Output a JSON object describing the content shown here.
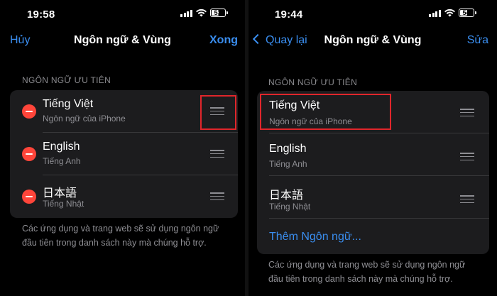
{
  "left": {
    "status": {
      "time": "19:58",
      "battery": "53"
    },
    "nav": {
      "left_button": "Hủy",
      "title": "Ngôn ngữ & Vùng",
      "right_button": "Xong"
    },
    "section_header": "NGÔN NGỮ ƯU TIÊN",
    "languages": [
      {
        "name": "Tiếng Việt",
        "subtitle": "Ngôn ngữ của iPhone"
      },
      {
        "name": "English",
        "subtitle": "Tiếng Anh"
      },
      {
        "name": "日本語",
        "subtitle": "Tiếng Nhật"
      }
    ],
    "footer_lines": [
      "Các ứng dụng và trang web sẽ sử dụng ngôn ngữ",
      "đầu tiên trong danh sách này mà chúng hỗ trợ."
    ]
  },
  "right": {
    "status": {
      "time": "19:44",
      "battery": "54"
    },
    "nav": {
      "back_button": "Quay lại",
      "title": "Ngôn ngữ & Vùng",
      "right_button": "Sửa"
    },
    "section_header": "NGÔN NGỮ ƯU TIÊN",
    "languages": [
      {
        "name": "Tiếng Việt",
        "subtitle": "Ngôn ngữ của iPhone"
      },
      {
        "name": "English",
        "subtitle": "Tiếng Anh"
      },
      {
        "name": "日本語",
        "subtitle": "Tiếng Nhật"
      }
    ],
    "add_language": "Thêm Ngôn ngữ...",
    "footer_lines": [
      "Các ứng dụng và trang web sẽ sử dụng ngôn ngữ",
      "đầu tiên trong danh sách này mà chúng hỗ trợ."
    ]
  },
  "colors": {
    "accent": "#3a8ef0",
    "delete": "#ff453a",
    "highlight": "#e0262b",
    "cell": "#1c1c1e"
  }
}
